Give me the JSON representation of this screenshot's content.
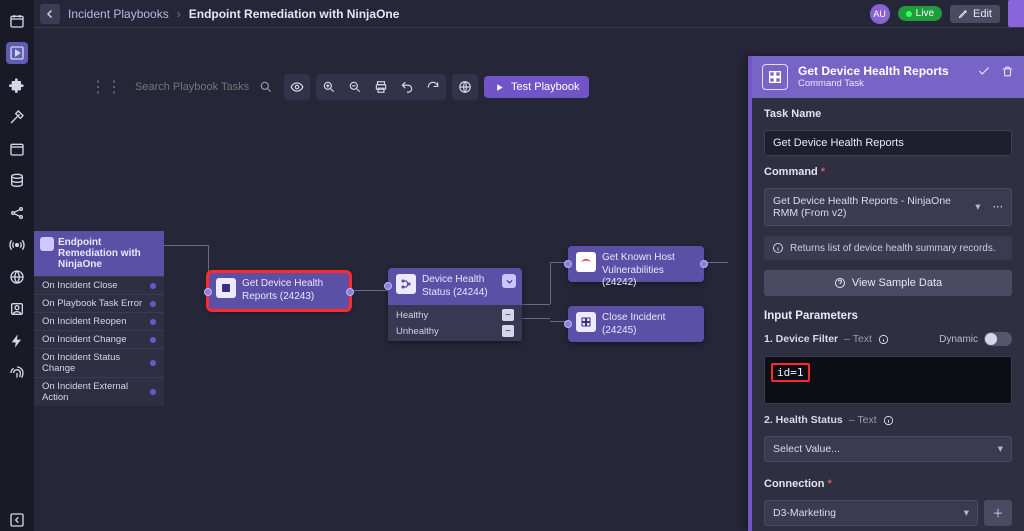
{
  "breadcrumb": {
    "root": "Incident Playbooks",
    "current": "Endpoint Remediation with NinjaOne"
  },
  "topright": {
    "avatar": "AU",
    "live": "Live",
    "edit": "Edit"
  },
  "toolbar": {
    "search_placeholder": "Search Playbook Tasks",
    "test_btn": "Test Playbook"
  },
  "start_node": {
    "title": "Endpoint Remediation with NinjaOne",
    "triggers": [
      "On Incident Close",
      "On Playbook Task Error",
      "On Incident Reopen",
      "On Incident Change",
      "On Incident Status Change",
      "On Incident External Action"
    ]
  },
  "nodes": {
    "get_reports": "Get Device Health Reports (24243)",
    "status": "Device Health Status (24244)",
    "branches": [
      "Healthy",
      "Unhealthy"
    ],
    "known_host": "Get Known Host Vulnerabilities (24242)",
    "close": "Close Incident (24245)"
  },
  "panel": {
    "title": "Get Device Health Reports",
    "subtitle": "Command Task",
    "task_name_label": "Task Name",
    "task_name_value": "Get Device Health Reports",
    "command_label": "Command",
    "command_value": "Get Device Health Reports - NinjaOne RMM (From v2)",
    "command_info": "Returns list of device health summary records.",
    "sample_btn": "View Sample Data",
    "input_params_label": "Input Parameters",
    "p1_label": "1. Device Filter",
    "p1_type": "– Text",
    "dynamic_label": "Dynamic",
    "p1_value": "id=1",
    "p2_label": "2. Health Status",
    "p2_type": "– Text",
    "p2_value": "Select Value...",
    "conn_label": "Connection",
    "conn_value": "D3-Marketing"
  }
}
